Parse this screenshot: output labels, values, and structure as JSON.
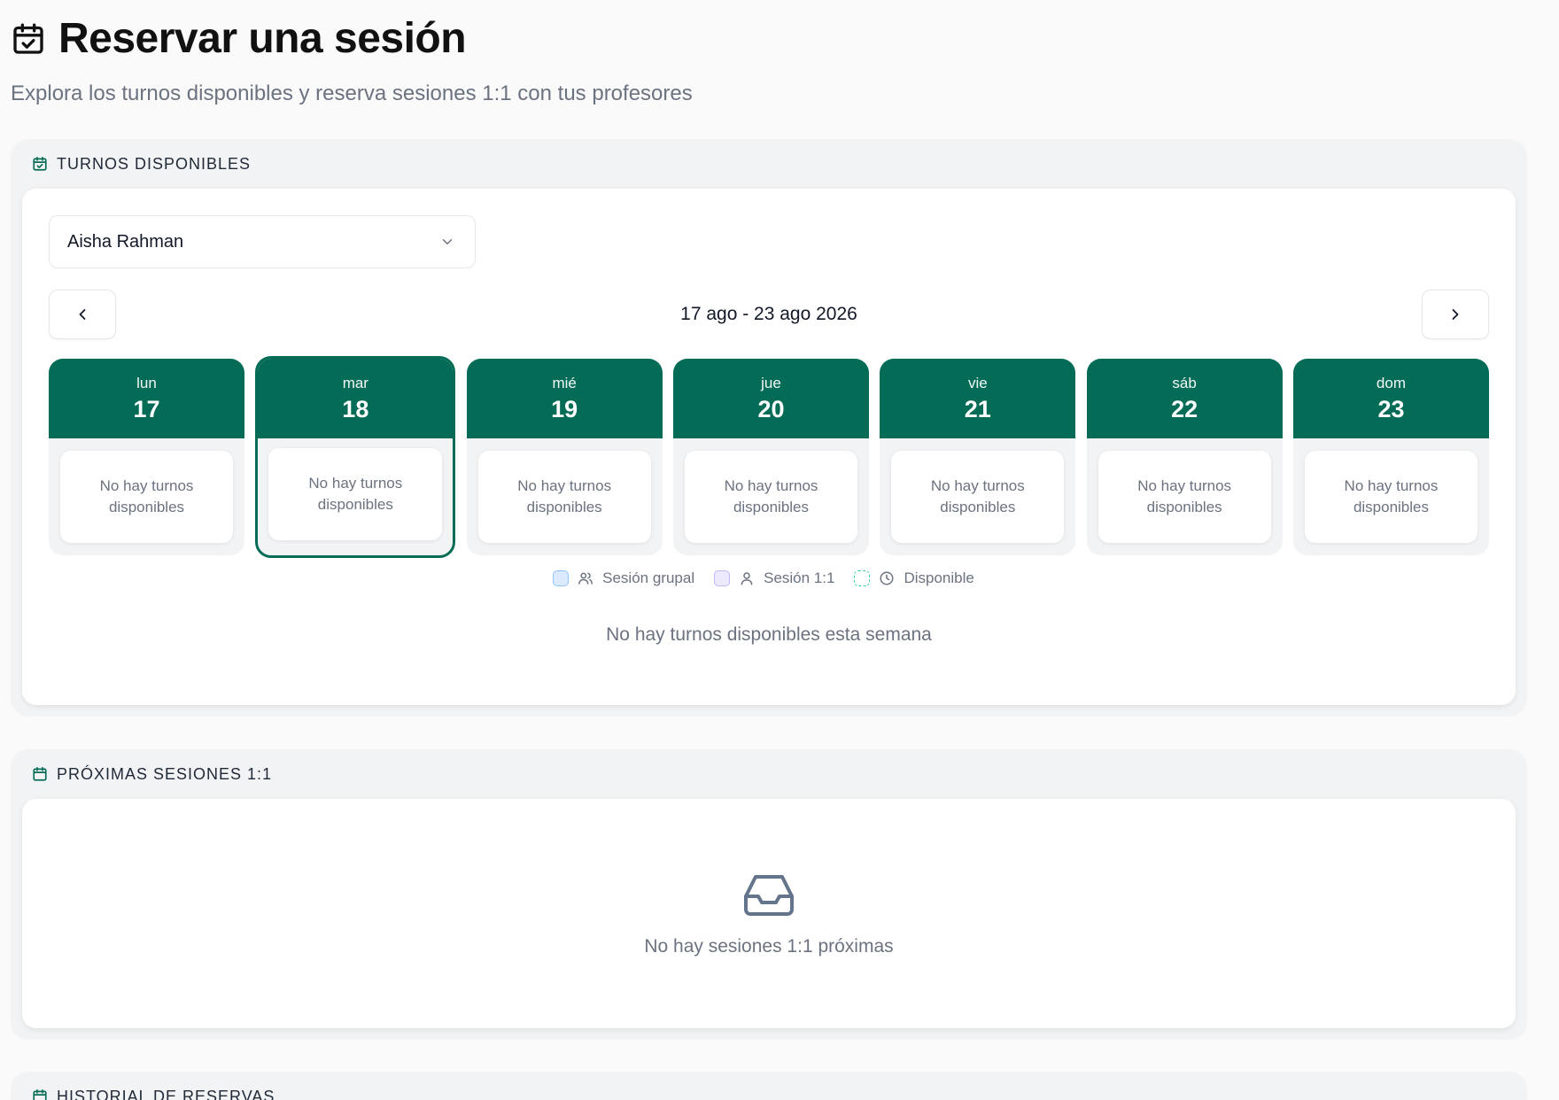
{
  "header": {
    "title": "Reservar una sesión",
    "subtitle": "Explora los turnos disponibles y reserva sesiones 1:1 con tus profesores",
    "icon": "calendar-check-icon"
  },
  "turnos": {
    "section_title": "TURNOS DISPONIBLES",
    "teacher_select": {
      "value": "Aisha Rahman"
    },
    "week_range": "17 ago - 23 ago 2026",
    "days": [
      {
        "name": "lun",
        "num": "17",
        "empty": "No hay turnos disponibles"
      },
      {
        "name": "mar",
        "num": "18",
        "empty": "No hay turnos disponibles"
      },
      {
        "name": "mié",
        "num": "19",
        "empty": "No hay turnos disponibles"
      },
      {
        "name": "jue",
        "num": "20",
        "empty": "No hay turnos disponibles"
      },
      {
        "name": "vie",
        "num": "21",
        "empty": "No hay turnos disponibles"
      },
      {
        "name": "sáb",
        "num": "22",
        "empty": "No hay turnos disponibles"
      },
      {
        "name": "dom",
        "num": "23",
        "empty": "No hay turnos disponibles"
      }
    ],
    "selected_day": "18",
    "legend": {
      "group": "Sesión grupal",
      "one_to_one": "Sesión 1:1",
      "available": "Disponible"
    },
    "week_empty": "No hay turnos disponibles esta semana"
  },
  "proximas": {
    "section_title": "PRÓXIMAS SESIONES 1:1",
    "empty": "No hay sesiones 1:1 próximas"
  },
  "historial": {
    "section_title": "HISTORIAL DE RESERVAS"
  },
  "colors": {
    "accent": "#046c56",
    "page_bg": "#fafafa",
    "section_bg": "#f2f3f4"
  }
}
